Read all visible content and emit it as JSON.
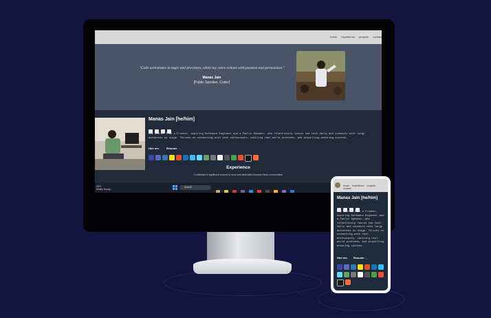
{
  "desktop": {
    "nav_links": [
      "home",
      "experience",
      "projects",
      "contact"
    ],
    "quote": "\"Code articulates in logic and precision, while my voice echoes with passion and persuasion.\"",
    "hero_name": "Manas Jain",
    "hero_role": "[Public Speaker, Coder]",
    "about_name": "Manas Jain [he/him]",
    "bio": "Hey there! I am a Fresher, aspiring Software Engineer and a Public Speaker, who relentlessly learns new tech daily and connects with large audiences on stage. Thrives on connecting with tech enthusiasts, tackling real-world problems, and propelling enduring success.",
    "hire_label": "Hire me.",
    "resume_label": "Resume →",
    "experience_title": "Experience",
    "experience_sub": "Contributed a significant amount of work and dedication towards these communities.",
    "taskbar": {
      "weather_temp": "28°C",
      "weather_desc": "Mostly cloudy",
      "search_placeholder": "Search"
    }
  },
  "phone": {
    "nav_links": [
      "home",
      "experience",
      "projects",
      "contact"
    ],
    "name": "Manas Jain [he/him]",
    "bio": "Hey there! I am a Fresher, aspiring Software Engineer and a Public Speaker, who relentlessly learns new tech daily and connects with large audiences on stage. Thrives on connecting with tech enthusiasts, tackling real-world problems, and propelling enduring success.",
    "hire_label": "Hire me.",
    "resume_label": "Resume →"
  },
  "colors": {
    "background": "#141440",
    "hero": "#4a5467",
    "section": "#202a3a"
  }
}
